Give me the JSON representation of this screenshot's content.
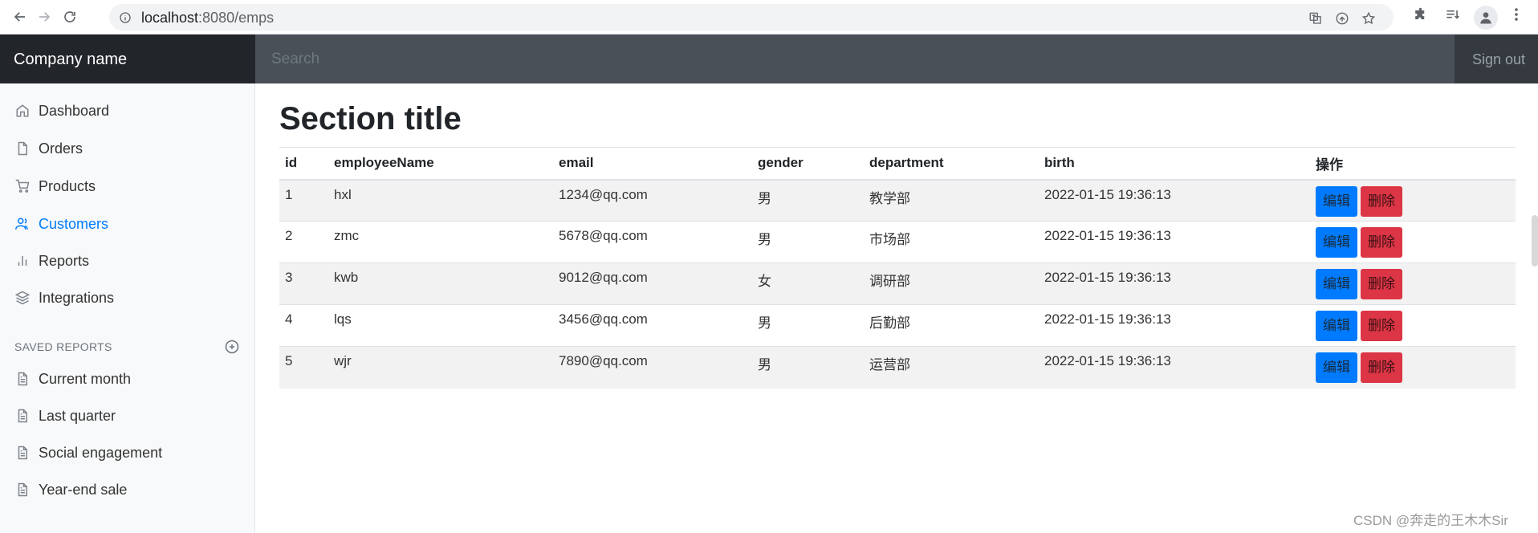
{
  "browser": {
    "url_host": "localhost",
    "url_path": ":8080/emps"
  },
  "navbar": {
    "brand": "Company name",
    "search_placeholder": "Search",
    "signout_label": "Sign out"
  },
  "sidebar": {
    "items": [
      {
        "label": "Dashboard",
        "icon": "home-icon",
        "active": false
      },
      {
        "label": "Orders",
        "icon": "file-icon",
        "active": false
      },
      {
        "label": "Products",
        "icon": "shopping-cart-icon",
        "active": false
      },
      {
        "label": "Customers",
        "icon": "users-icon",
        "active": true
      },
      {
        "label": "Reports",
        "icon": "bar-chart-icon",
        "active": false
      },
      {
        "label": "Integrations",
        "icon": "layers-icon",
        "active": false
      }
    ],
    "saved_heading": "SAVED REPORTS",
    "saved": [
      {
        "label": "Current month",
        "icon": "file-text-icon"
      },
      {
        "label": "Last quarter",
        "icon": "file-text-icon"
      },
      {
        "label": "Social engagement",
        "icon": "file-text-icon"
      },
      {
        "label": "Year-end sale",
        "icon": "file-text-icon"
      }
    ]
  },
  "main": {
    "title": "Section title",
    "columns": [
      "id",
      "employeeName",
      "email",
      "gender",
      "department",
      "birth",
      "操作"
    ],
    "rows": [
      {
        "id": "1",
        "name": "hxl",
        "email": "1234@qq.com",
        "gender": "男",
        "department": "教学部",
        "birth": "2022-01-15 19:36:13"
      },
      {
        "id": "2",
        "name": "zmc",
        "email": "5678@qq.com",
        "gender": "男",
        "department": "市场部",
        "birth": "2022-01-15 19:36:13"
      },
      {
        "id": "3",
        "name": "kwb",
        "email": "9012@qq.com",
        "gender": "女",
        "department": "调研部",
        "birth": "2022-01-15 19:36:13"
      },
      {
        "id": "4",
        "name": "lqs",
        "email": "3456@qq.com",
        "gender": "男",
        "department": "后勤部",
        "birth": "2022-01-15 19:36:13"
      },
      {
        "id": "5",
        "name": "wjr",
        "email": "7890@qq.com",
        "gender": "男",
        "department": "运营部",
        "birth": "2022-01-15 19:36:13"
      }
    ],
    "edit_label": "编辑",
    "delete_label": "删除"
  },
  "watermark": "CSDN @奔走的王木木Sir",
  "colors": {
    "accent": "#007bff",
    "danger": "#dc3545",
    "navbar": "#343a40"
  }
}
